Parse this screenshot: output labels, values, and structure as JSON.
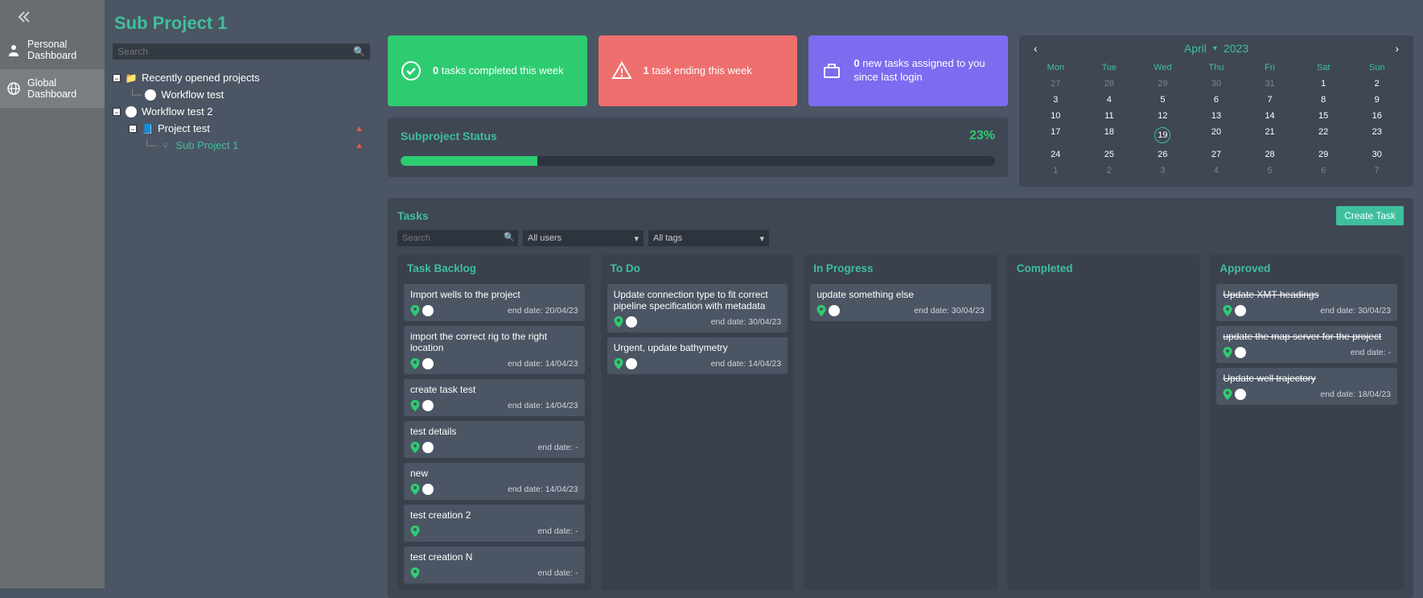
{
  "nav": {
    "personal": "Personal Dashboard",
    "global": "Global Dashboard"
  },
  "page_title": "Sub Project 1",
  "tree_search_placeholder": "Search",
  "tree": {
    "recent": "Recently opened projects",
    "wf1": "Workflow test",
    "wf2": "Workflow test 2",
    "proj": "Project test",
    "sub": "Sub Project 1"
  },
  "stats": {
    "green_num": "0",
    "green_text": " tasks completed this week",
    "red_num": "1",
    "red_text": " task ending this week",
    "purple_num": "0",
    "purple_text": " new tasks assigned to you since last login"
  },
  "calendar": {
    "month": "April",
    "year": "2023",
    "dow": [
      "Mon",
      "Tue",
      "Wed",
      "Thu",
      "Fri",
      "Sat",
      "Sun"
    ],
    "days": [
      {
        "n": "27",
        "m": true
      },
      {
        "n": "28",
        "m": true
      },
      {
        "n": "29",
        "m": true
      },
      {
        "n": "30",
        "m": true
      },
      {
        "n": "31",
        "m": true
      },
      {
        "n": "1"
      },
      {
        "n": "2"
      },
      {
        "n": "3"
      },
      {
        "n": "4"
      },
      {
        "n": "5"
      },
      {
        "n": "6"
      },
      {
        "n": "7"
      },
      {
        "n": "8"
      },
      {
        "n": "9"
      },
      {
        "n": "10"
      },
      {
        "n": "11"
      },
      {
        "n": "12"
      },
      {
        "n": "13"
      },
      {
        "n": "14"
      },
      {
        "n": "15"
      },
      {
        "n": "16"
      },
      {
        "n": "17"
      },
      {
        "n": "18"
      },
      {
        "n": "19",
        "today": true
      },
      {
        "n": "20"
      },
      {
        "n": "21"
      },
      {
        "n": "22"
      },
      {
        "n": "23"
      },
      {
        "n": "24"
      },
      {
        "n": "25"
      },
      {
        "n": "26"
      },
      {
        "n": "27"
      },
      {
        "n": "28"
      },
      {
        "n": "29"
      },
      {
        "n": "30"
      },
      {
        "n": "1",
        "m": true
      },
      {
        "n": "2",
        "m": true
      },
      {
        "n": "3",
        "m": true
      },
      {
        "n": "4",
        "m": true
      },
      {
        "n": "5",
        "m": true
      },
      {
        "n": "6",
        "m": true
      },
      {
        "n": "7",
        "m": true
      }
    ]
  },
  "status": {
    "title": "Subproject Status",
    "percent_label": "23%",
    "percent": 23
  },
  "tasks": {
    "title": "Tasks",
    "create": "Create Task",
    "search_placeholder": "Search",
    "filter_users": "All users",
    "filter_tags": "All tags",
    "columns": [
      {
        "name": "Task Backlog",
        "cards": [
          {
            "title": "Import wells to the project",
            "end": "end date: 20/04/23",
            "avatar": true
          },
          {
            "title": "import the correct rig to the right location",
            "end": "end date: 14/04/23",
            "avatar": true
          },
          {
            "title": "create task test",
            "end": "end date: 14/04/23",
            "avatar": true
          },
          {
            "title": "test details",
            "end": "end date: -",
            "avatar": true
          },
          {
            "title": "new",
            "end": "end date: 14/04/23",
            "avatar": true
          },
          {
            "title": "test creation 2",
            "end": "end date: -",
            "avatar": false
          },
          {
            "title": "test creation N",
            "end": "end date: -",
            "avatar": false
          }
        ]
      },
      {
        "name": "To Do",
        "cards": [
          {
            "title": "Update connection type to fit correct pipeline specification with metadata",
            "end": "end date: 30/04/23",
            "avatar": true
          },
          {
            "title": "Urgent, update bathymetry",
            "end": "end date: 14/04/23",
            "avatar": true
          }
        ]
      },
      {
        "name": "In Progress",
        "cards": [
          {
            "title": "update something else",
            "end": "end date: 30/04/23",
            "avatar": true
          }
        ]
      },
      {
        "name": "Completed",
        "cards": []
      },
      {
        "name": "Approved",
        "strike": true,
        "cards": [
          {
            "title": "Update XMT headings",
            "end": "end date: 30/04/23",
            "avatar": true
          },
          {
            "title": "update the map server for the project",
            "end": "end date: -",
            "avatar": true
          },
          {
            "title": "Update well trajectory",
            "end": "end date: 18/04/23",
            "avatar": true
          }
        ]
      }
    ]
  }
}
